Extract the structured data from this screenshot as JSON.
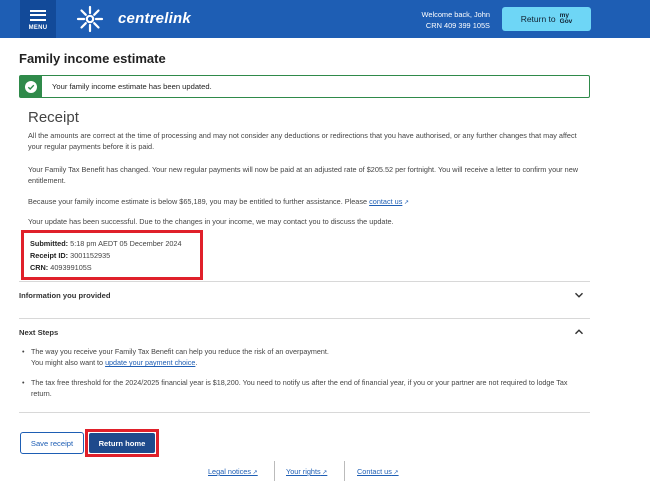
{
  "header": {
    "menu_label": "MENU",
    "brand": "centrelink",
    "welcome": "Welcome back, John",
    "crn": "CRN 409 399 105S",
    "return_to": "Return to",
    "mygov_line1": "my",
    "mygov_line2": "Gov",
    "brand_color": "#1e5eb4"
  },
  "page": {
    "title": "Family income estimate",
    "alert_text": "Your family income estimate has been updated.",
    "receipt_heading": "Receipt",
    "para1": "All the amounts are correct at the time of processing and may not consider any deductions or redirections that you have authorised, or any further changes that may affect your regular payments before it is paid.",
    "para2": "Your Family Tax Benefit has changed. Your new regular payments will now be paid at an adjusted rate of $205.52 per fortnight. You will receive a letter to confirm your new entitlement.",
    "para3_prefix": "Because your family income estimate is below $65,189, you may be entitled to further assistance. Please ",
    "para3_link": "contact us",
    "para4": "Your update has been successful. Due to the changes in your income, we may contact you to discuss the update."
  },
  "details": {
    "submitted_label": "Submitted:",
    "submitted_value": "5:18 pm AEDT 05 December 2024",
    "receipt_label": "Receipt ID:",
    "receipt_value": "3001152935",
    "crn_label": "CRN:",
    "crn_value": "409399105S"
  },
  "accordions": {
    "info_title": "Information you provided",
    "next_title": "Next Steps"
  },
  "next_steps": {
    "b1_line1": "The way you receive your Family Tax Benefit can help you reduce the risk of an overpayment.",
    "b1_line2_prefix": "You might also want to ",
    "b1_link": "update your payment choice",
    "b1_suffix": ".",
    "b2": "The tax free threshold for the 2024/2025 financial year is $18,200. You need to notify us after the end of financial year, if you or your partner are not required to lodge Tax return."
  },
  "buttons": {
    "save_receipt": "Save receipt",
    "return_home": "Return home"
  },
  "footer": {
    "legal": "Legal notices",
    "rights": "Your rights",
    "contact": "Contact us"
  }
}
